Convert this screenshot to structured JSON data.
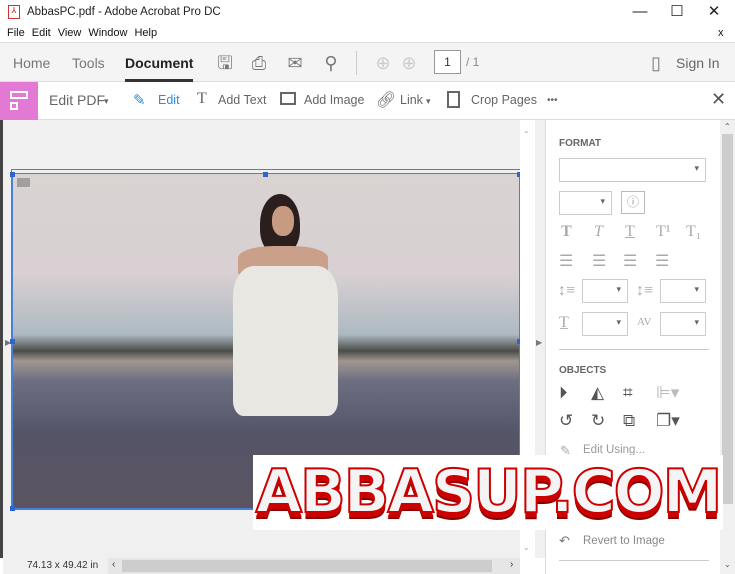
{
  "window": {
    "title": "AbbasPC.pdf - Adobe Acrobat Pro DC",
    "minimize": "—",
    "maximize": "☐",
    "close": "✕",
    "doc_close": "x"
  },
  "menu": [
    "File",
    "Edit",
    "View",
    "Window",
    "Help"
  ],
  "toolbar": {
    "tabs": [
      "Home",
      "Tools",
      "Document"
    ],
    "page_current": "1",
    "page_total": "/ 1",
    "sign_in": "Sign In"
  },
  "editbar": {
    "edit_pdf": "Edit PDF",
    "edit": "Edit",
    "add_text": "Add Text",
    "add_image": "Add Image",
    "link": "Link",
    "crop_pages": "Crop Pages",
    "more": "•••"
  },
  "panel": {
    "format": "FORMAT",
    "objects": "OBJECTS",
    "edit_using": "Edit Using...",
    "revert": "Revert to Image"
  },
  "status": {
    "dimensions": "74.13 x 49.42 in"
  },
  "watermark": "ABBASUP.COM",
  "colors": {
    "accent": "#e27ad5",
    "selection": "#2f63d0",
    "edit_blue": "#2d8ae0"
  }
}
